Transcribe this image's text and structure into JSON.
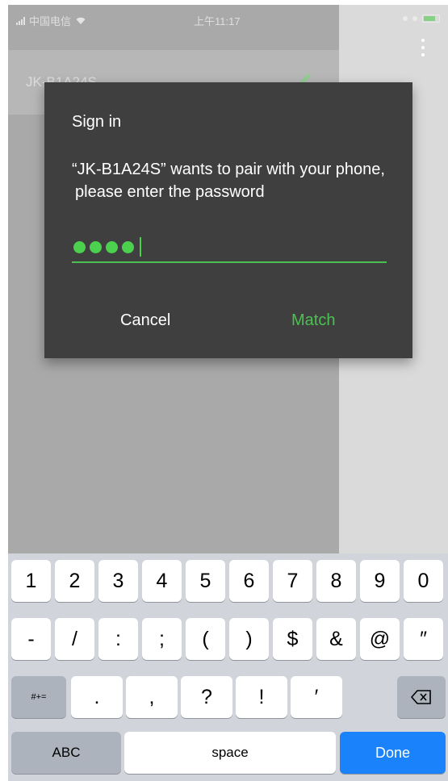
{
  "status_bar": {
    "carrier": "中国电信",
    "time": "上午11:17"
  },
  "device_list": {
    "device_name": "JK-B1A24S"
  },
  "dialog": {
    "title": "Sign in",
    "message_line1": "“JK-B1A24S” wants to pair with your phone,",
    "message_line2": "please enter the password",
    "password_length": 4,
    "cancel_label": "Cancel",
    "match_label": "Match",
    "accent_color": "#4cc152"
  },
  "keyboard": {
    "row1": [
      "1",
      "2",
      "3",
      "4",
      "5",
      "6",
      "7",
      "8",
      "9",
      "0"
    ],
    "row2": [
      "-",
      "/",
      ":",
      ";",
      "(",
      ")",
      "$",
      "&",
      "@",
      "″"
    ],
    "row3": {
      "symbols_toggle": "#+=",
      "keys": [
        ".",
        ",",
        "?",
        "!",
        "′"
      ]
    },
    "row4": {
      "abc": "ABC",
      "space": "space",
      "done": "Done"
    }
  }
}
